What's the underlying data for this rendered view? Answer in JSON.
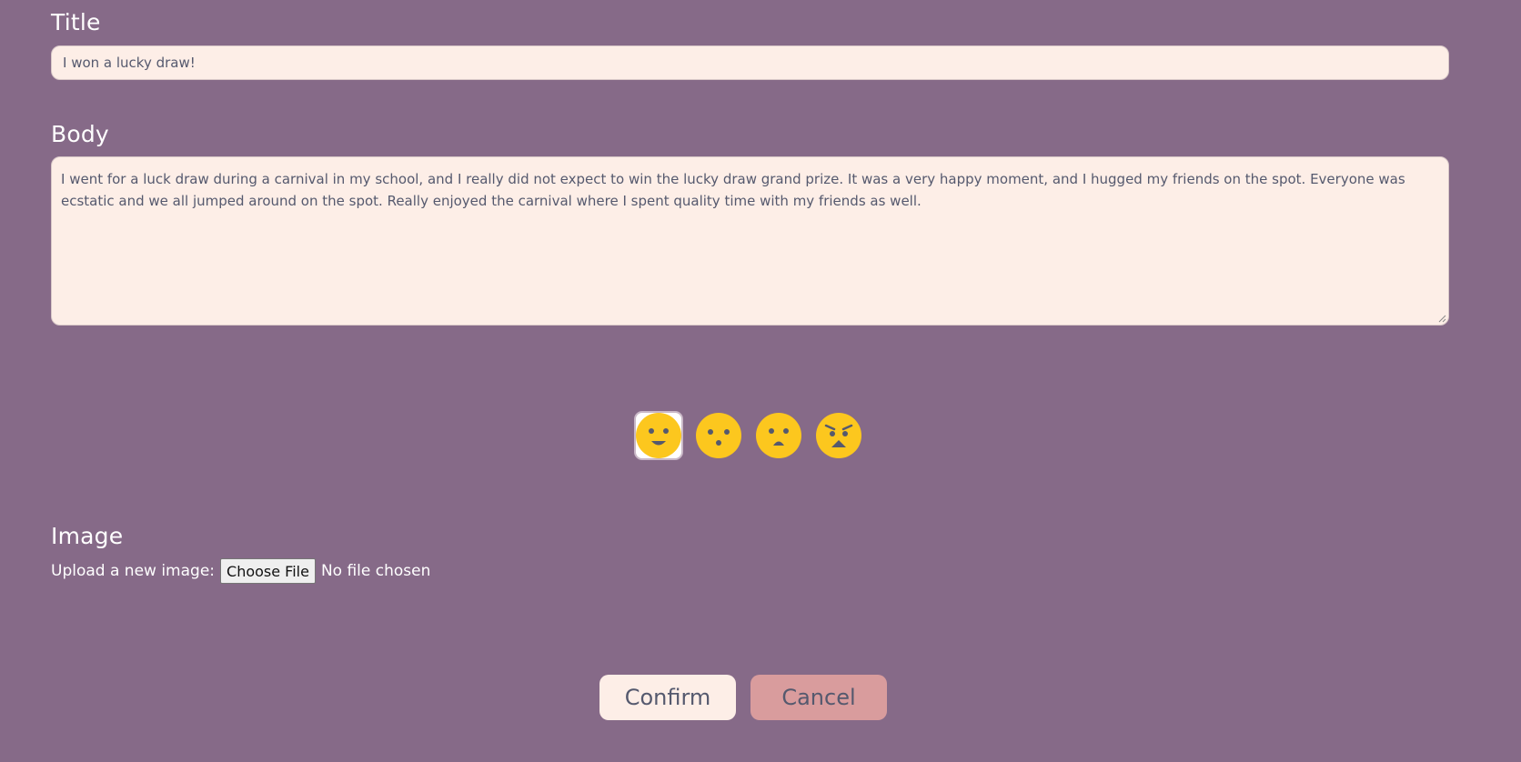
{
  "form": {
    "title_label": "Title",
    "title_value": "I won a lucky draw!",
    "body_label": "Body",
    "body_value": "I went for a luck draw during a carnival in my school, and I really did not expect to win the lucky draw grand prize. It was a very happy moment, and I hugged my friends on the spot. Everyone was ecstatic and we all jumped around on the spot. Really enjoyed the carnival where I spent quality time with my friends as well.",
    "image_label": "Image",
    "upload_label": "Upload a new image:",
    "choose_file_label": "Choose File",
    "no_file_text": "No file chosen"
  },
  "moods": [
    {
      "name": "happy-face-icon",
      "selected": true
    },
    {
      "name": "surprised-face-icon",
      "selected": false
    },
    {
      "name": "sad-face-icon",
      "selected": false
    },
    {
      "name": "angry-face-icon",
      "selected": false
    }
  ],
  "actions": {
    "confirm_label": "Confirm",
    "cancel_label": "Cancel"
  },
  "colors": {
    "background": "#866a88",
    "input_background": "#fdeee7",
    "emoji_yellow": "#fcc71e",
    "cancel_button": "#d99c9d",
    "text_dark": "#55596e"
  }
}
